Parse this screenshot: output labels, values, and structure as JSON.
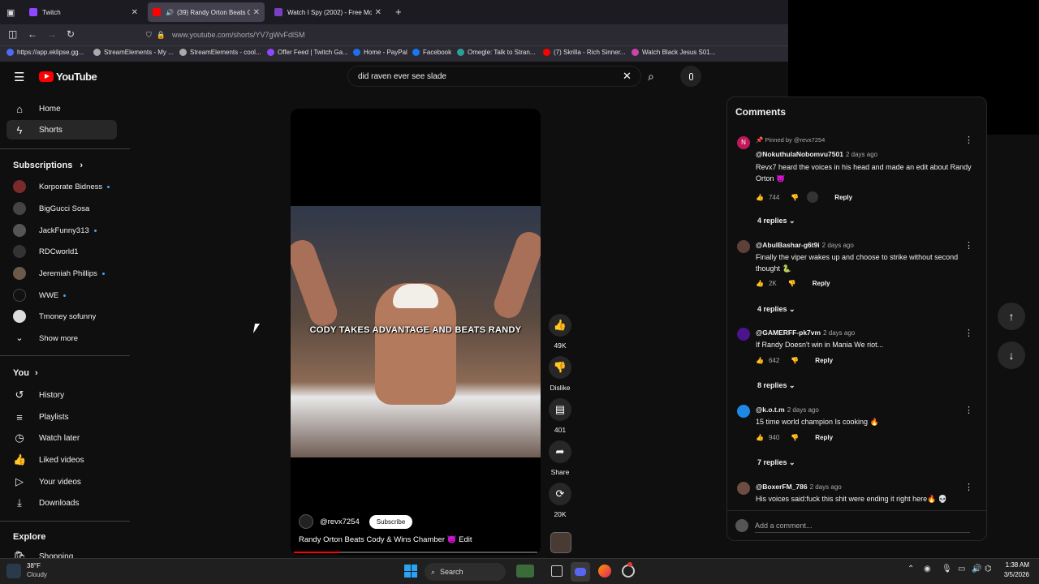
{
  "browser": {
    "tabs": [
      {
        "label": "Twitch",
        "close": "✕"
      },
      {
        "label": "(39) Randy Orton Beats Co",
        "close": "✕"
      },
      {
        "label": "Watch I Spy (2002) - Free Movi",
        "close": "✕"
      }
    ],
    "new_tab": "+",
    "url": "www.youtube.com/shorts/YV7gWvFdlSM",
    "bookmarks": [
      "https://app.eklipse.gg...",
      "StreamElements - My ...",
      "StreamElements - cool...",
      "Offer Feed | Twitch Ga...",
      "Home - PayPal",
      "Facebook",
      "Omegle: Talk to Stran...",
      "(7) Skrilla - Rich Sinner...",
      "Watch Black Jesus S01..."
    ]
  },
  "youtube": {
    "logo": "YouTube",
    "search_query": "did raven ever see slade",
    "sidebar": {
      "main": [
        {
          "label": "Home",
          "icon": "home-icon"
        },
        {
          "label": "Shorts",
          "icon": "shorts-icon"
        }
      ],
      "subscriptions_title": "Subscriptions",
      "subscriptions": [
        {
          "label": "Korporate Bidness",
          "dot": true
        },
        {
          "label": "BigGucci Sosa",
          "dot": false
        },
        {
          "label": "JackFunny313",
          "dot": true
        },
        {
          "label": "RDCworld1",
          "dot": false
        },
        {
          "label": "Jeremiah Phillips",
          "dot": true
        },
        {
          "label": "WWE",
          "dot": true
        },
        {
          "label": "Tmoney sofunny",
          "dot": false
        }
      ],
      "show_more": "Show more",
      "you_title": "You",
      "you_items": [
        {
          "label": "History",
          "icon": "history-icon"
        },
        {
          "label": "Playlists",
          "icon": "playlists-icon"
        },
        {
          "label": "Watch later",
          "icon": "watch-later-icon"
        },
        {
          "label": "Liked videos",
          "icon": "liked-videos-icon"
        },
        {
          "label": "Your videos",
          "icon": "your-videos-icon"
        },
        {
          "label": "Downloads",
          "icon": "downloads-icon"
        }
      ],
      "explore_title": "Explore",
      "explore_items": [
        {
          "label": "Shopping",
          "icon": "shopping-icon"
        }
      ]
    },
    "video": {
      "caption": "CODY TAKES ADVANTAGE AND BEATS RANDY",
      "channel": "@revx7254",
      "subscribe": "Subscribe",
      "title": "Randy Orton Beats Cody & Wins Chamber 😈 Edit",
      "progress": 0.19
    },
    "actions": {
      "likes": "49K",
      "dislike": "Dislike",
      "comments": "401",
      "share": "Share",
      "remix": "20K"
    },
    "comments_panel": {
      "title": "Comments",
      "items": [
        {
          "pinned": "Pinned by @revx7254",
          "author": "@NokuthulaNobomvu7501",
          "time": "2 days ago",
          "text": "Revx7 heard the voices in his head and made an edit about Randy Orton 😈",
          "likes": "744",
          "reply": "Reply",
          "replies": "4 replies"
        },
        {
          "author": "@AbulBashar-g6t9i",
          "time": "2 days ago",
          "text": "Finally the viper wakes up and choose to strike without second thought 🐍",
          "likes": "2K",
          "reply": "Reply",
          "replies": "4 replies"
        },
        {
          "author": "@GAMERFF-pk7vm",
          "time": "2 days ago",
          "text": "If Randy Doesn't win in Mania We riot...",
          "likes": "642",
          "reply": "Reply",
          "replies": "8 replies"
        },
        {
          "author": "@k.o.t.m",
          "time": "2 days ago",
          "text": "15 time world champion Is cooking 🔥",
          "likes": "940",
          "reply": "Reply",
          "replies": "7 replies"
        },
        {
          "author": "@BoxerFM_786",
          "time": "2 days ago",
          "text": "His voices said:fuck this shit were ending it right here🔥 💀",
          "likes": "",
          "reply": "",
          "replies": ""
        }
      ],
      "add_placeholder": "Add a comment..."
    }
  },
  "taskbar": {
    "weather_temp": "38°F",
    "weather_desc": "Cloudy",
    "search": "Search",
    "time": "1:38 AM",
    "date": "3/5/2026"
  }
}
